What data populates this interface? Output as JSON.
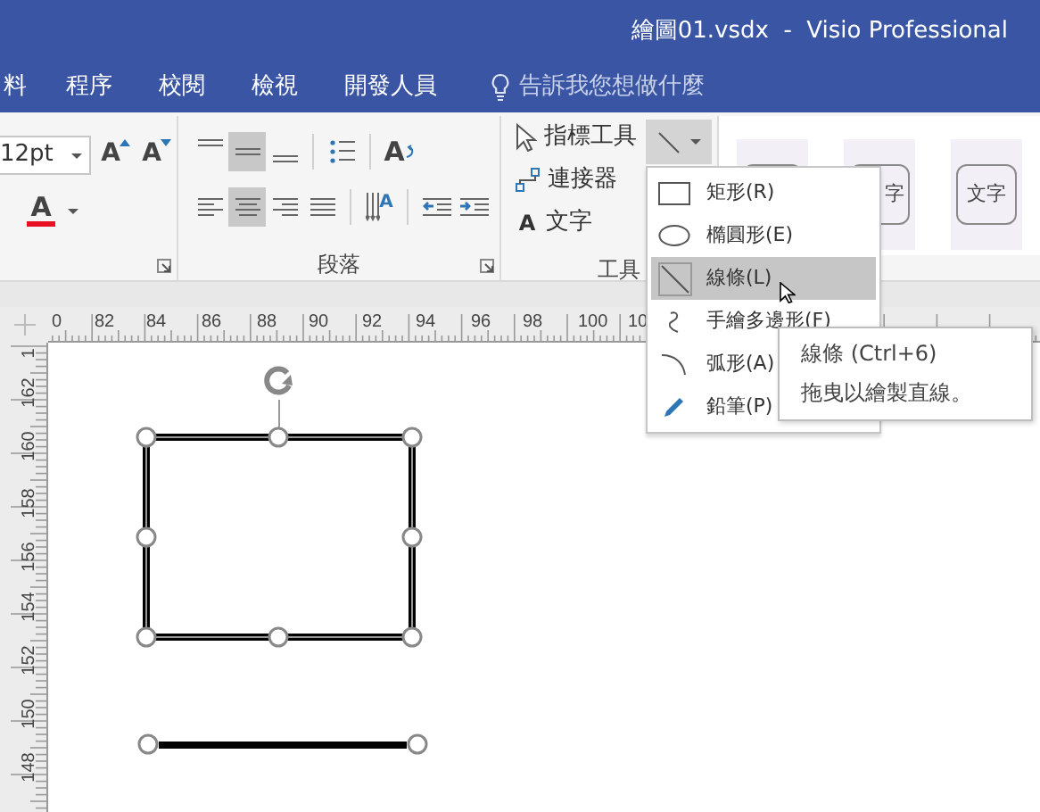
{
  "window": {
    "title": "繪圖01.vsdx  -  Visio Professional"
  },
  "tabs": [
    {
      "label": "料",
      "selected": false
    },
    {
      "label": "程序",
      "selected": false
    },
    {
      "label": "校閱",
      "selected": false
    },
    {
      "label": "檢視",
      "selected": false
    },
    {
      "label": "開發人員",
      "selected": false
    }
  ],
  "tell_me": {
    "placeholder": "告訴我您想做什麼"
  },
  "font_group": {
    "font_size": "12pt",
    "grow_label": "A",
    "shrink_label": "A",
    "font_color_label": "A"
  },
  "paragraph_group": {
    "label": "段落",
    "row_1": [
      {
        "kind": "align-top",
        "selected": false
      },
      {
        "kind": "align-middle",
        "selected": true
      },
      {
        "kind": "align-bottom",
        "selected": false
      },
      {
        "kind": "bullets",
        "selected": false
      },
      {
        "kind": "text-direction",
        "label": "A",
        "selected": false
      }
    ],
    "row_2": [
      {
        "kind": "align-left",
        "selected": false
      },
      {
        "kind": "align-center",
        "selected": true
      },
      {
        "kind": "align-right",
        "selected": false
      },
      {
        "kind": "justify",
        "selected": false
      },
      {
        "kind": "spacing",
        "label": "A",
        "selected": false
      },
      {
        "kind": "outdent",
        "selected": false
      },
      {
        "kind": "indent",
        "selected": false
      }
    ]
  },
  "tools_group": {
    "label": "工具",
    "items": [
      {
        "kind": "pointer",
        "label": "指標工具"
      },
      {
        "kind": "connector",
        "label": "連接器"
      },
      {
        "kind": "text",
        "icon_label": "A",
        "label": "文字"
      }
    ],
    "shape_button": {
      "expanded": true
    }
  },
  "style_gallery": [
    {
      "kind": "blank"
    },
    {
      "kind": "text",
      "label": "字"
    },
    {
      "kind": "text",
      "label": "文字"
    }
  ],
  "shape_menu": [
    {
      "kind": "rectangle",
      "label": "矩形(R)",
      "selected": false
    },
    {
      "kind": "ellipse",
      "label": "橢圓形(E)",
      "selected": false
    },
    {
      "kind": "line",
      "label": "線條(L)",
      "selected": true
    },
    {
      "kind": "freeform",
      "label": "手繪多邊形(F)",
      "selected": false
    },
    {
      "kind": "arc",
      "label": "弧形(A)",
      "selected": false
    },
    {
      "kind": "pencil",
      "label": "鉛筆(P)",
      "selected": false
    }
  ],
  "tooltip": {
    "title": "線條 (Ctrl+6)",
    "description": "拖曳以繪製直線。"
  },
  "horizontal_ruler": [
    "0",
    "82",
    "84",
    "86",
    "88",
    "90",
    "92",
    "94",
    "96",
    "98",
    "100",
    "10"
  ],
  "vertical_ruler": [
    "1",
    "162",
    "160",
    "158",
    "156",
    "154",
    "152",
    "150",
    "148"
  ],
  "canvas": {
    "shapes": [
      {
        "kind": "rectangle",
        "selected": true
      },
      {
        "kind": "line",
        "selected": true
      }
    ]
  }
}
